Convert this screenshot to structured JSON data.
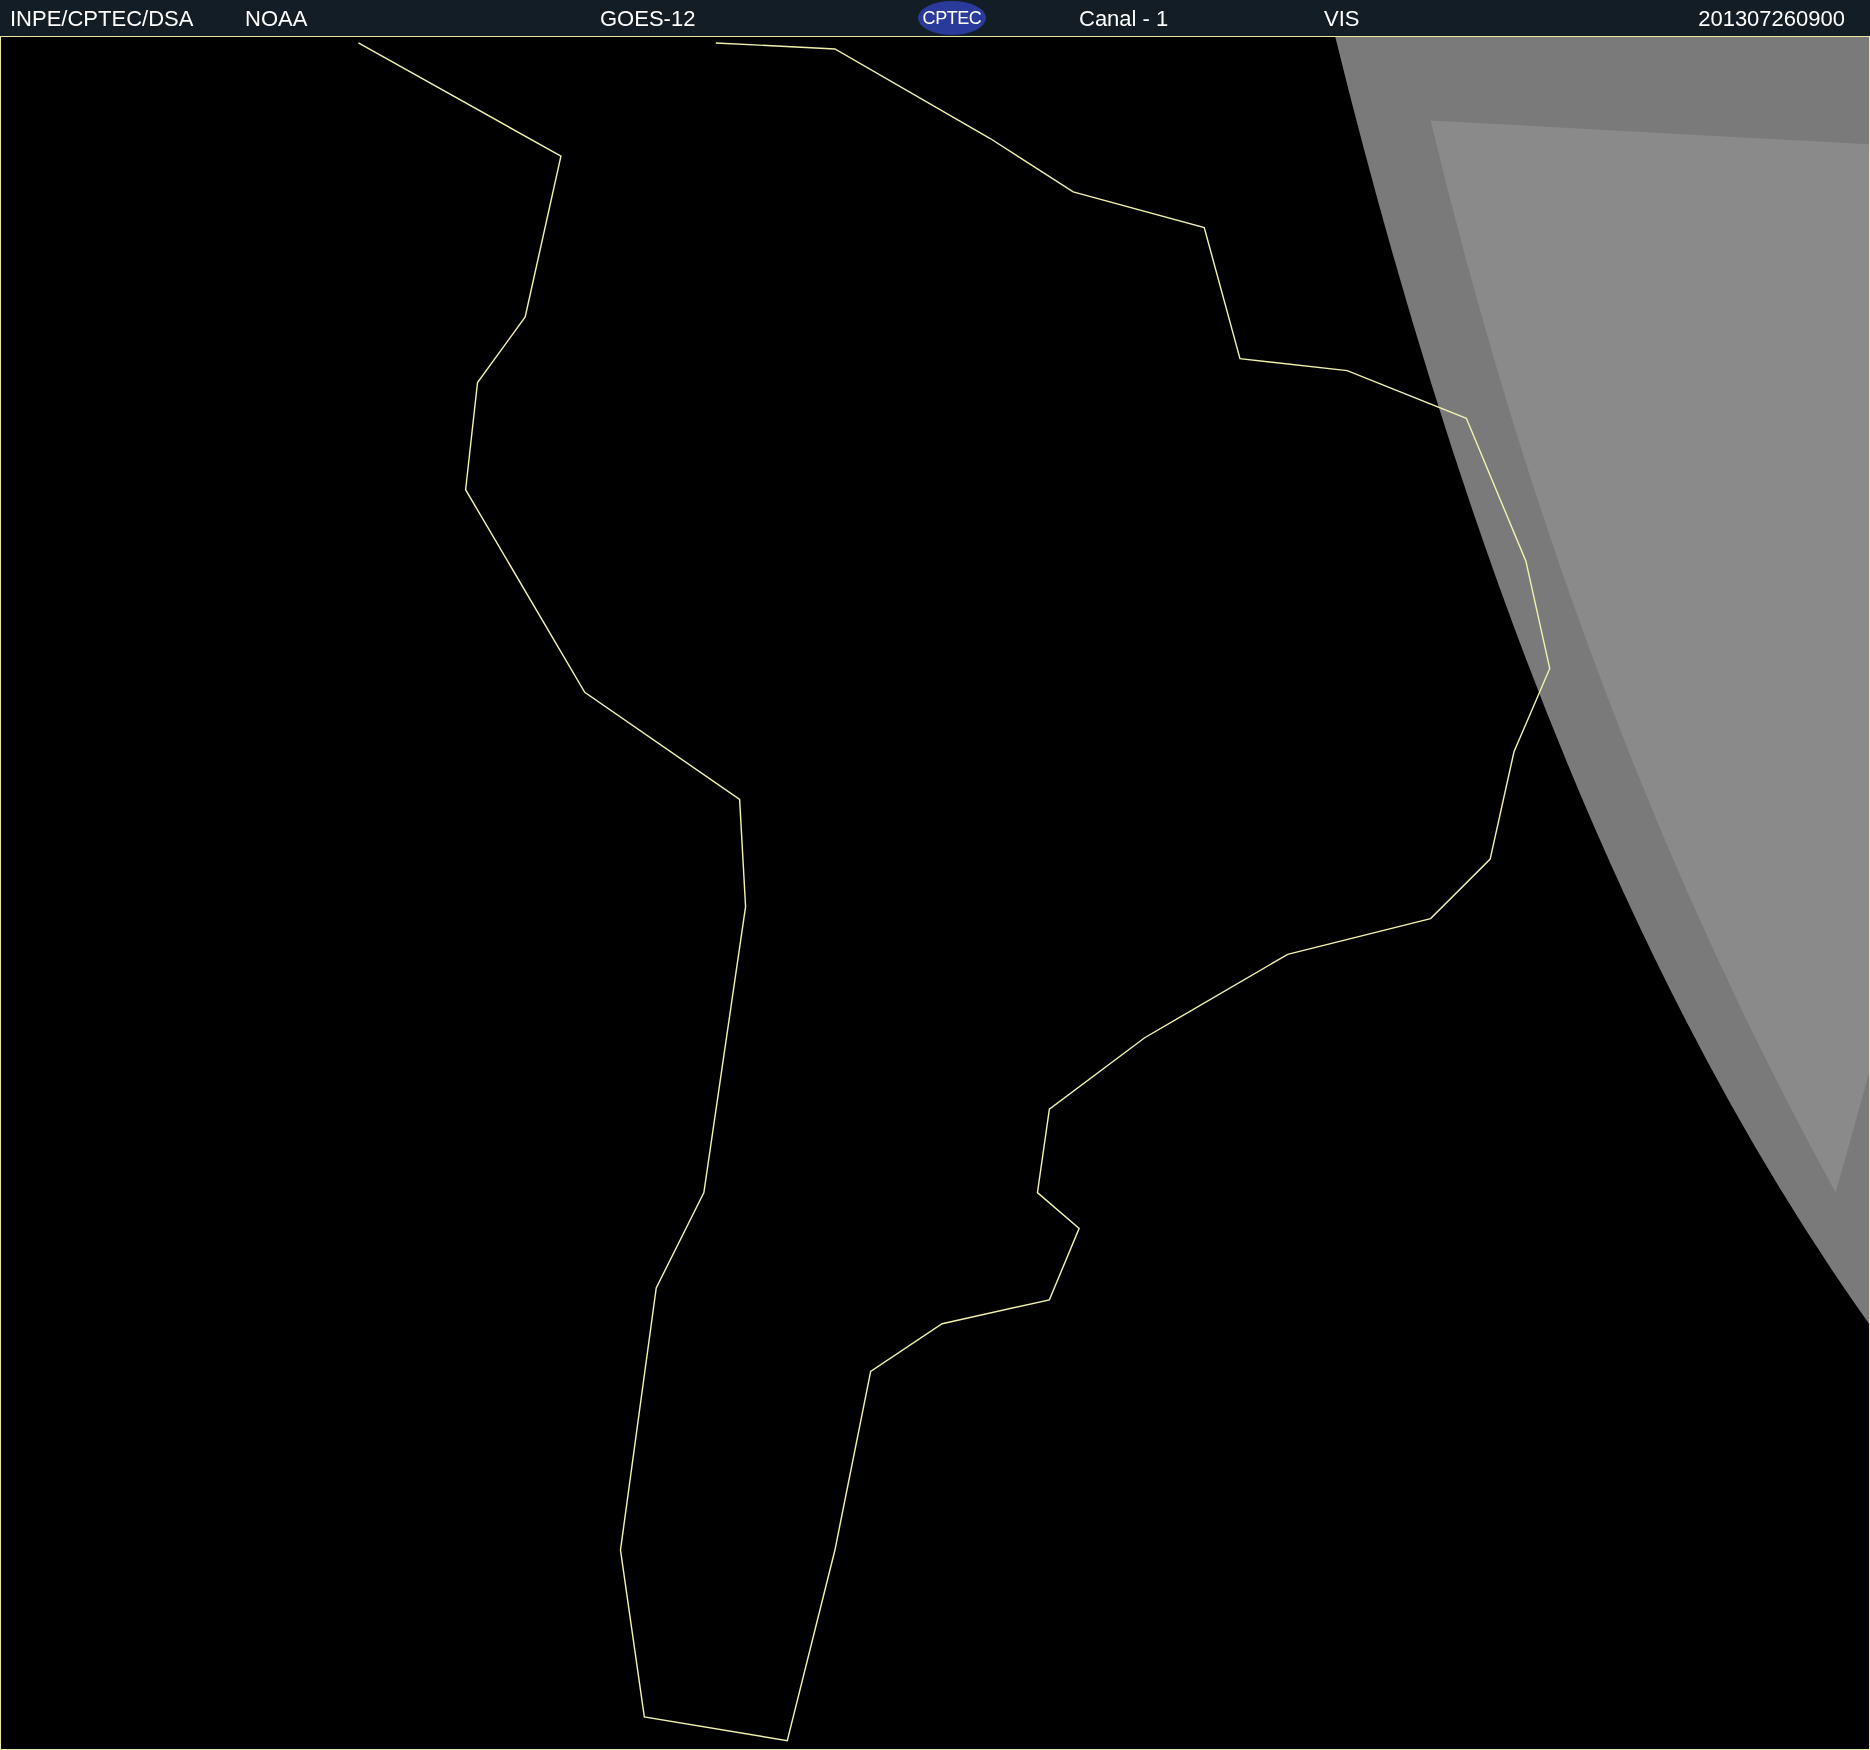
{
  "header": {
    "source": "INPE/CPTEC/DSA",
    "agency": "NOAA",
    "satellite": "GOES-12",
    "logo": "CPTEC",
    "channel": "Canal - 1",
    "band": "VIS",
    "timestamp": "201307260900"
  }
}
